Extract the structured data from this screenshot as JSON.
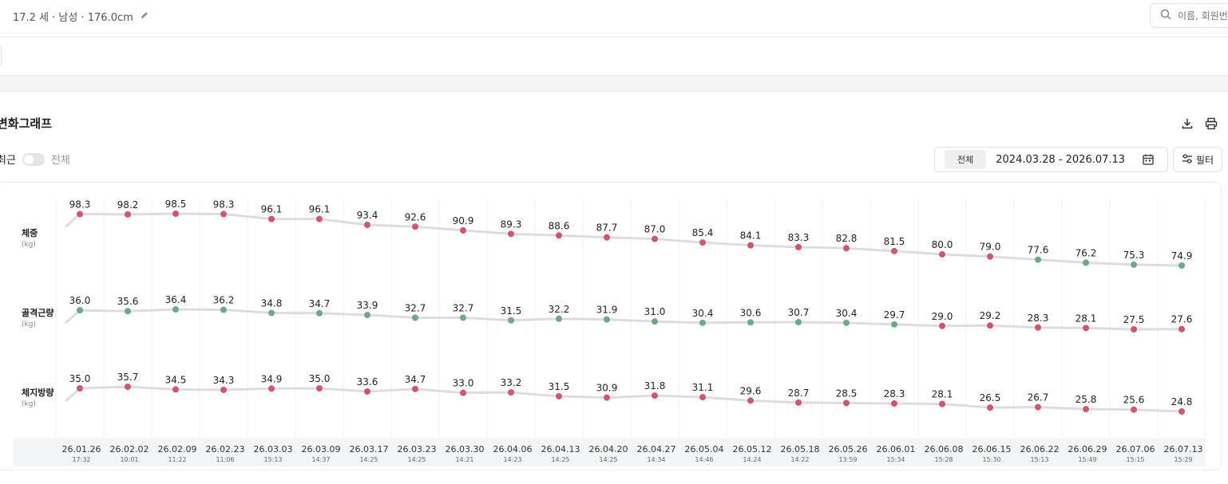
{
  "header": {
    "profile_text": "17.2 세 · 남성 · 176.0cm",
    "search_placeholder": "이름, 회원번"
  },
  "section": {
    "title": "변화그래프",
    "toggle_left": "최근",
    "toggle_right": "전체",
    "period_chip": "전체",
    "date_range": "2024.03.28 - 2026.07.13",
    "filter_label": "필터"
  },
  "colors": {
    "red": "#d0566e",
    "green": "#6aab86",
    "line": "#dcdde2"
  },
  "chart_data": {
    "type": "line",
    "x": [
      {
        "date": "26.01.26",
        "time": "17:32"
      },
      {
        "date": "26.02.02",
        "time": "10:01"
      },
      {
        "date": "26.02.09",
        "time": "11:22"
      },
      {
        "date": "26.02.23",
        "time": "11:06"
      },
      {
        "date": "26.03.03",
        "time": "15:13"
      },
      {
        "date": "26.03.09",
        "time": "14:37"
      },
      {
        "date": "26.03.17",
        "time": "14:25"
      },
      {
        "date": "26.03.23",
        "time": "14:25"
      },
      {
        "date": "26.03.30",
        "time": "14:21"
      },
      {
        "date": "26.04.06",
        "time": "14:23"
      },
      {
        "date": "26.04.13",
        "time": "14:25"
      },
      {
        "date": "26.04.20",
        "time": "14:25"
      },
      {
        "date": "26.04.27",
        "time": "14:34"
      },
      {
        "date": "26.05.04",
        "time": "14:46"
      },
      {
        "date": "26.05.12",
        "time": "14:24"
      },
      {
        "date": "26.05.18",
        "time": "14:22"
      },
      {
        "date": "26.05.26",
        "time": "13:59"
      },
      {
        "date": "26.06.01",
        "time": "15:34"
      },
      {
        "date": "26.06.08",
        "time": "15:28"
      },
      {
        "date": "26.06.15",
        "time": "15:30"
      },
      {
        "date": "26.06.22",
        "time": "15:13"
      },
      {
        "date": "26.06.29",
        "time": "15:49"
      },
      {
        "date": "26.07.06",
        "time": "15:15"
      },
      {
        "date": "26.07.13",
        "time": "15:29"
      }
    ],
    "series": [
      {
        "name": "체중",
        "unit": "(kg)",
        "values": [
          98.3,
          98.2,
          98.5,
          98.3,
          96.1,
          96.1,
          93.4,
          92.6,
          90.9,
          89.3,
          88.6,
          87.7,
          87.0,
          85.4,
          84.1,
          83.3,
          82.8,
          81.5,
          80.0,
          79.0,
          77.6,
          76.2,
          75.3,
          74.9
        ],
        "status": [
          "r",
          "r",
          "r",
          "r",
          "r",
          "r",
          "r",
          "r",
          "r",
          "r",
          "r",
          "r",
          "r",
          "r",
          "r",
          "r",
          "r",
          "r",
          "r",
          "r",
          "g",
          "g",
          "g",
          "g"
        ]
      },
      {
        "name": "골격근량",
        "unit": "(kg)",
        "values": [
          36.0,
          35.6,
          36.4,
          36.2,
          34.8,
          34.7,
          33.9,
          32.7,
          32.7,
          31.5,
          32.2,
          31.9,
          31.0,
          30.4,
          30.6,
          30.7,
          30.4,
          29.7,
          29.0,
          29.2,
          28.3,
          28.1,
          27.5,
          27.6
        ],
        "status": [
          "g",
          "g",
          "g",
          "g",
          "g",
          "g",
          "g",
          "g",
          "g",
          "g",
          "g",
          "g",
          "g",
          "g",
          "g",
          "g",
          "g",
          "g",
          "r",
          "r",
          "r",
          "r",
          "r",
          "r"
        ]
      },
      {
        "name": "체지방량",
        "unit": "(kg)",
        "values": [
          35.0,
          35.7,
          34.5,
          34.3,
          34.9,
          35.0,
          33.6,
          34.7,
          33.0,
          33.2,
          31.5,
          30.9,
          31.8,
          31.1,
          29.6,
          28.7,
          28.5,
          28.3,
          28.1,
          26.5,
          26.7,
          25.8,
          25.6,
          24.8
        ],
        "status": [
          "r",
          "r",
          "r",
          "r",
          "r",
          "r",
          "r",
          "r",
          "r",
          "r",
          "r",
          "r",
          "r",
          "r",
          "r",
          "r",
          "r",
          "r",
          "r",
          "r",
          "r",
          "r",
          "r",
          "r"
        ]
      }
    ]
  }
}
